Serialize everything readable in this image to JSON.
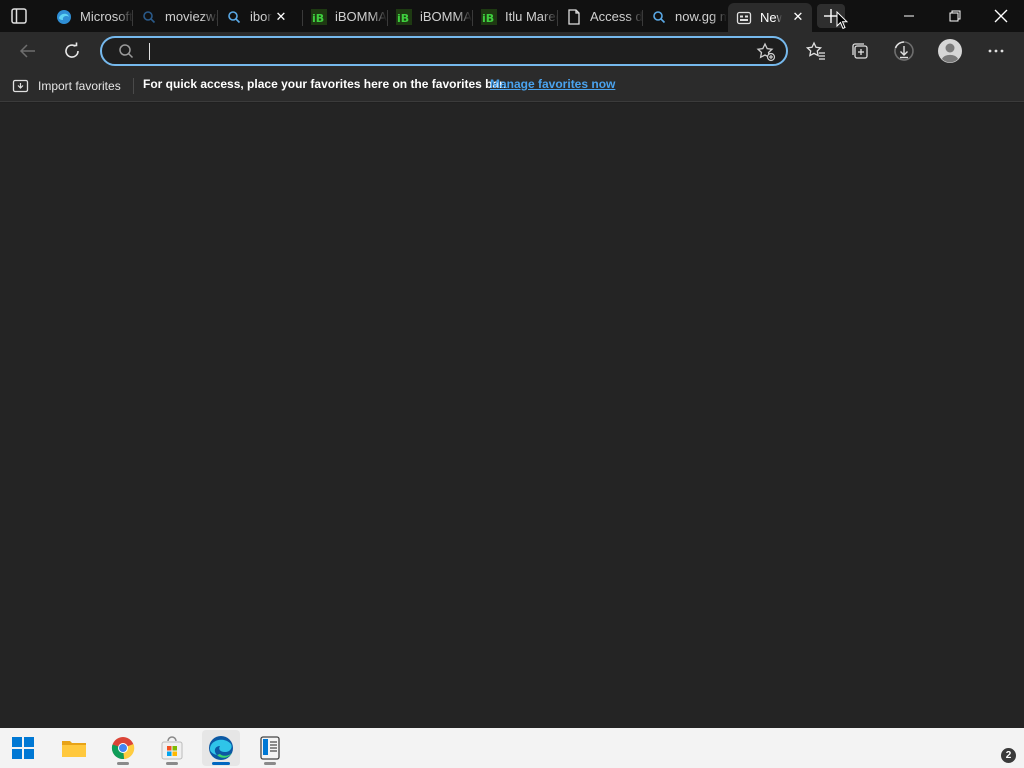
{
  "browser": {
    "tabs": [
      {
        "title": "Microsoft",
        "favicon": "edge-icon"
      },
      {
        "title": "moviezwap",
        "favicon": "search-icon"
      },
      {
        "title": "ibomma",
        "favicon": "search-icon"
      },
      {
        "title": "iBOMMA",
        "favicon": "ibomma-icon"
      },
      {
        "title": "iBOMMA",
        "favicon": "ibomma-icon"
      },
      {
        "title": "Itlu Maredumilli",
        "favicon": "ibomma-icon"
      },
      {
        "title": "Access denied",
        "favicon": "page-icon"
      },
      {
        "title": "now.gg m",
        "favicon": "search-icon"
      },
      {
        "title": "New tab",
        "favicon": "newtab-icon",
        "active": true
      }
    ],
    "address_bar": {
      "value": "",
      "placeholder": ""
    },
    "favorites_bar": {
      "import_label": "Import favorites",
      "message": "For quick access, place your favorites here on the favorites bar.",
      "link": "Manage favorites now"
    }
  },
  "taskbar": {
    "apps": [
      "start-icon",
      "file-explorer-icon",
      "chrome-icon",
      "store-icon",
      "edge-icon",
      "reader-icon"
    ],
    "notification_count": "2"
  },
  "colors": {
    "titlebar": "#111111",
    "toolbar": "#2b2b2b",
    "content": "#242424",
    "accent": "#76b9ed",
    "link": "#4aa3ee",
    "ibomma_green": "#3ecf3e"
  }
}
